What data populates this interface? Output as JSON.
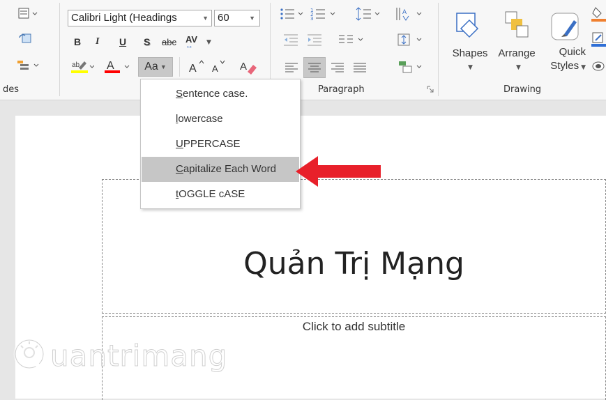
{
  "ribbon": {
    "font": {
      "name": "Calibri Light (Headings",
      "size": "60",
      "bold": "B",
      "italic": "I",
      "underline": "U",
      "shadow": "S",
      "strikethrough": "abc",
      "char_spacing": "AV",
      "change_case": "Aa",
      "grow": "A",
      "shrink": "A"
    },
    "groups": {
      "slides_label": "des",
      "paragraph_label": "Paragraph",
      "drawing_label": "Drawing"
    },
    "drawing": {
      "shapes": "Shapes",
      "arrange": "Arrange",
      "quick": "Quick",
      "styles": "Styles"
    }
  },
  "change_case_menu": {
    "items": [
      {
        "label": "Sentence case.",
        "highlighted": false
      },
      {
        "label": "lowercase",
        "highlighted": false
      },
      {
        "label": "UPPERCASE",
        "highlighted": false
      },
      {
        "label": "Capitalize Each Word",
        "highlighted": true
      },
      {
        "label": "tOGGLE cASE",
        "highlighted": false
      }
    ]
  },
  "annotation": {
    "color": "#e8202a",
    "icon": "red-arrow-icon"
  },
  "slide": {
    "title": "Quản Trị Mạng",
    "subtitle_placeholder": "Click to add subtitle"
  },
  "watermark": {
    "text": "uantrimang",
    "icon": "bulb-q-icon"
  },
  "colors": {
    "highlight_yellow": "#ffff00",
    "font_red": "#ff0000",
    "menu_highlight": "#c6c6c6",
    "drawing_orange": "#f08030",
    "drawing_blue": "#2f6fd6"
  }
}
